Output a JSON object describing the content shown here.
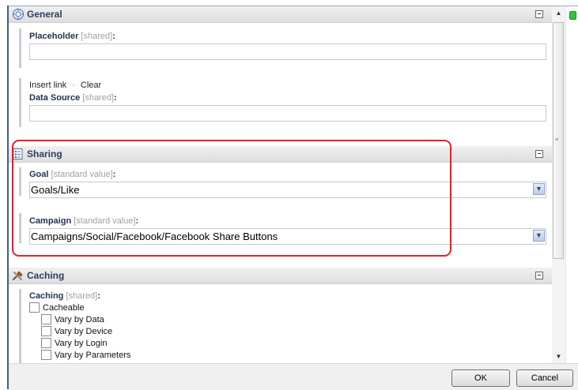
{
  "sections": {
    "general": {
      "title": "General",
      "fields": {
        "placeholder": {
          "label": "Placeholder",
          "note": "[shared]",
          "colon": ":",
          "value": ""
        },
        "links": {
          "insert": "Insert link",
          "separator": "·",
          "clear": "Clear"
        },
        "data_source": {
          "label": "Data Source",
          "note": "[shared]",
          "colon": ":",
          "value": ""
        }
      }
    },
    "sharing": {
      "title": "Sharing",
      "fields": {
        "goal": {
          "label": "Goal",
          "note": "[standard value]",
          "colon": ":",
          "value": "Goals/Like"
        },
        "campaign": {
          "label": "Campaign",
          "note": "[standard value]",
          "colon": ":",
          "value": "Campaigns/Social/Facebook/Facebook Share Buttons"
        }
      }
    },
    "caching": {
      "title": "Caching",
      "fields": {
        "caching": {
          "label": "Caching",
          "note": "[shared]",
          "colon": ":"
        },
        "checkboxes": [
          {
            "label": "Cacheable",
            "checked": false
          },
          {
            "label": "Vary by Data",
            "checked": false
          },
          {
            "label": "Vary by Device",
            "checked": false
          },
          {
            "label": "Vary by Login",
            "checked": false
          },
          {
            "label": "Vary by Parameters",
            "checked": false
          }
        ]
      }
    }
  },
  "footer": {
    "ok_label": "OK",
    "cancel_label": "Cancel"
  },
  "colors": {
    "highlight": "#e0232a",
    "header_text": "#2c3f5f",
    "status_green": "#36c23a"
  },
  "icons": {
    "general": "gear-globe-icon",
    "sharing": "list-document-icon",
    "caching": "tools-icon"
  }
}
